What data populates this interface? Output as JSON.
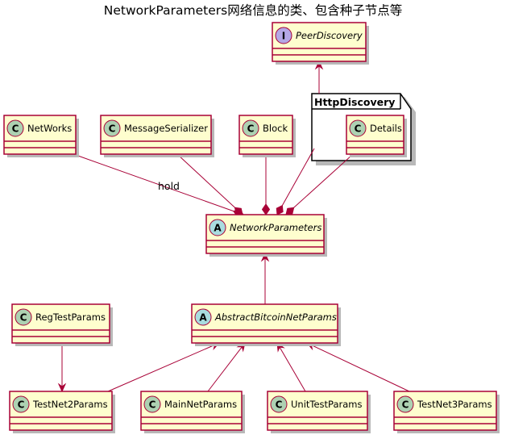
{
  "diagram": {
    "title": "NetworkParameters网络信息的类、包含种子节点等",
    "package": "HttpDiscovery",
    "edge_label": "hold",
    "nodes": [
      {
        "id": "PeerDiscovery",
        "badge": "I",
        "badge_color": "#B4A7E5",
        "name": "PeerDiscovery",
        "italic": true
      },
      {
        "id": "Details",
        "badge": "C",
        "badge_color": "#ADD1B2",
        "name": "Details",
        "italic": false
      },
      {
        "id": "NetWorks",
        "badge": "C",
        "badge_color": "#ADD1B2",
        "name": "NetWorks",
        "italic": false
      },
      {
        "id": "MessageSerializer",
        "badge": "C",
        "badge_color": "#ADD1B2",
        "name": "MessageSerializer",
        "italic": false
      },
      {
        "id": "Block",
        "badge": "C",
        "badge_color": "#ADD1B2",
        "name": "Block",
        "italic": false
      },
      {
        "id": "NetworkParameters",
        "badge": "A",
        "badge_color": "#A9DCDF",
        "name": "NetworkParameters",
        "italic": true
      },
      {
        "id": "RegTestParams",
        "badge": "C",
        "badge_color": "#ADD1B2",
        "name": "RegTestParams",
        "italic": false
      },
      {
        "id": "AbstractBitcoinNetParams",
        "badge": "A",
        "badge_color": "#A9DCDF",
        "name": "AbstractBitcoinNetParams",
        "italic": true
      },
      {
        "id": "TestNet2Params",
        "badge": "C",
        "badge_color": "#ADD1B2",
        "name": "TestNet2Params",
        "italic": false
      },
      {
        "id": "MainNetParams",
        "badge": "C",
        "badge_color": "#ADD1B2",
        "name": "MainNetParams",
        "italic": false
      },
      {
        "id": "UnitTestParams",
        "badge": "C",
        "badge_color": "#ADD1B2",
        "name": "UnitTestParams",
        "italic": false
      },
      {
        "id": "TestNet3Params",
        "badge": "C",
        "badge_color": "#ADD1B2",
        "name": "TestNet3Params",
        "italic": false
      }
    ],
    "edges": [
      {
        "from": "NetWorks",
        "to": "NetworkParameters",
        "type": "composition",
        "label": "hold"
      },
      {
        "from": "MessageSerializer",
        "to": "NetworkParameters",
        "type": "composition"
      },
      {
        "from": "Block",
        "to": "NetworkParameters",
        "type": "composition"
      },
      {
        "from": "HttpDiscovery",
        "to": "NetworkParameters",
        "type": "composition"
      },
      {
        "from": "Details",
        "to": "NetworkParameters",
        "type": "composition"
      },
      {
        "from": "HttpDiscovery",
        "to": "PeerDiscovery",
        "type": "arrow"
      },
      {
        "from": "AbstractBitcoinNetParams",
        "to": "NetworkParameters",
        "type": "arrow"
      },
      {
        "from": "RegTestParams",
        "to": "TestNet2Params",
        "type": "arrow"
      },
      {
        "from": "TestNet2Params",
        "to": "AbstractBitcoinNetParams",
        "type": "arrow"
      },
      {
        "from": "MainNetParams",
        "to": "AbstractBitcoinNetParams",
        "type": "arrow"
      },
      {
        "from": "UnitTestParams",
        "to": "AbstractBitcoinNetParams",
        "type": "arrow"
      },
      {
        "from": "TestNet3Params",
        "to": "AbstractBitcoinNetParams",
        "type": "arrow"
      }
    ]
  }
}
